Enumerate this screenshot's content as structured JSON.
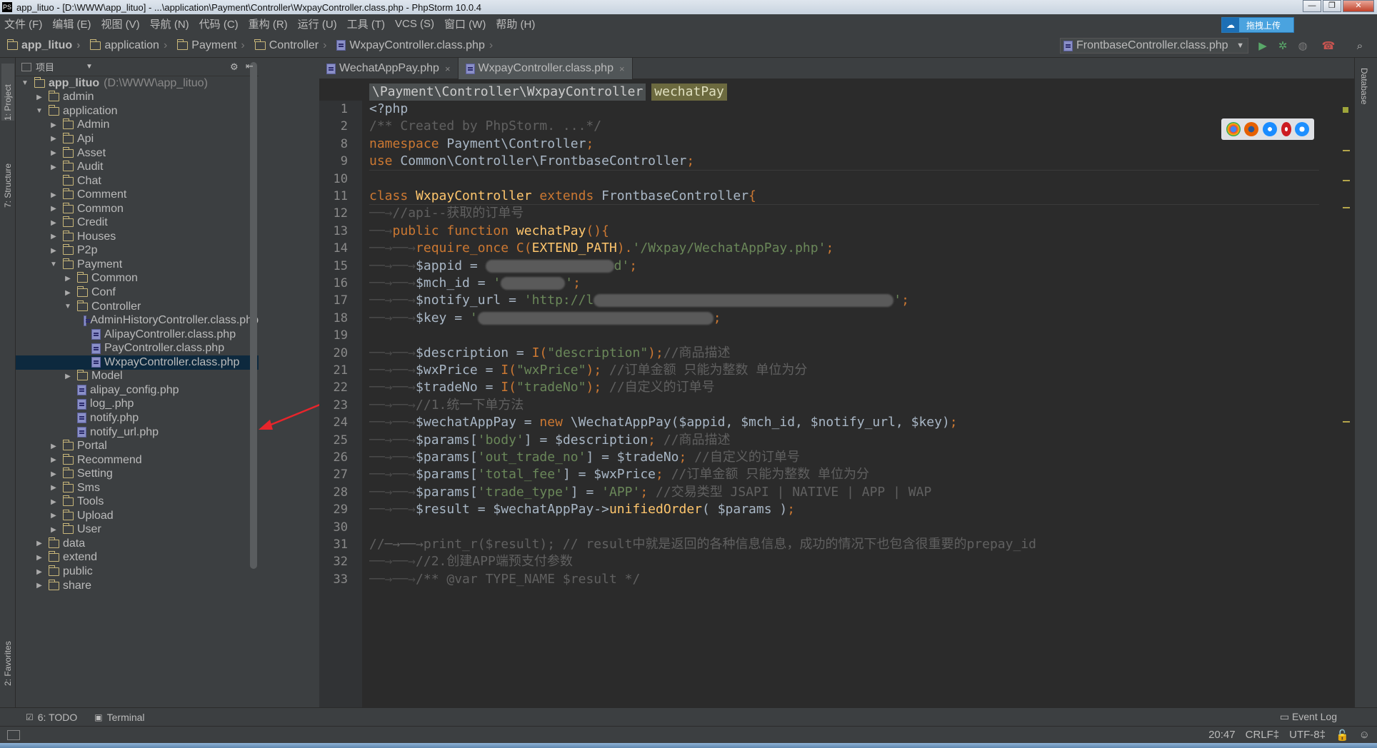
{
  "window": {
    "title": "app_lituo - [D:\\WWW\\app_lituo] - ...\\application\\Payment\\Controller\\WxpayController.class.php - PhpStorm 10.0.4",
    "app_icon_text": "PS",
    "minimize": "—",
    "restore": "❐",
    "close": "✕"
  },
  "menu": {
    "items": [
      "文件 (F)",
      "编辑 (E)",
      "视图 (V)",
      "导航 (N)",
      "代码 (C)",
      "重构 (R)",
      "运行 (U)",
      "工具 (T)",
      "VCS (S)",
      "窗口 (W)",
      "帮助 (H)"
    ],
    "upload_label": "拖拽上传"
  },
  "navbar": {
    "crumbs": [
      "app_lituo",
      "application",
      "Payment",
      "Controller",
      "WxpayController.class.php"
    ],
    "run_config": "FrontbaseController.class.php"
  },
  "left_strip": {
    "project": "1: Project",
    "structure": "7: Structure",
    "favorites": "2: Favorites"
  },
  "project_panel": {
    "header": "项目",
    "root": "app_lituo",
    "root_path": "(D:\\WWW\\app_lituo)",
    "tree": [
      {
        "label": "admin",
        "indent": 1,
        "arrow": "▶",
        "type": "folder"
      },
      {
        "label": "application",
        "indent": 1,
        "arrow": "▼",
        "type": "folder"
      },
      {
        "label": "Admin",
        "indent": 2,
        "arrow": "▶",
        "type": "folder"
      },
      {
        "label": "Api",
        "indent": 2,
        "arrow": "▶",
        "type": "folder"
      },
      {
        "label": "Asset",
        "indent": 2,
        "arrow": "▶",
        "type": "folder"
      },
      {
        "label": "Audit",
        "indent": 2,
        "arrow": "▶",
        "type": "folder"
      },
      {
        "label": "Chat",
        "indent": 2,
        "arrow": "",
        "type": "folder"
      },
      {
        "label": "Comment",
        "indent": 2,
        "arrow": "▶",
        "type": "folder"
      },
      {
        "label": "Common",
        "indent": 2,
        "arrow": "▶",
        "type": "folder"
      },
      {
        "label": "Credit",
        "indent": 2,
        "arrow": "▶",
        "type": "folder"
      },
      {
        "label": "Houses",
        "indent": 2,
        "arrow": "▶",
        "type": "folder"
      },
      {
        "label": "P2p",
        "indent": 2,
        "arrow": "▶",
        "type": "folder"
      },
      {
        "label": "Payment",
        "indent": 2,
        "arrow": "▼",
        "type": "folder"
      },
      {
        "label": "Common",
        "indent": 3,
        "arrow": "▶",
        "type": "folder"
      },
      {
        "label": "Conf",
        "indent": 3,
        "arrow": "▶",
        "type": "folder"
      },
      {
        "label": "Controller",
        "indent": 3,
        "arrow": "▼",
        "type": "folder"
      },
      {
        "label": "AdminHistoryController.class.php",
        "indent": 4,
        "arrow": "",
        "type": "php"
      },
      {
        "label": "AlipayController.class.php",
        "indent": 4,
        "arrow": "",
        "type": "php"
      },
      {
        "label": "PayController.class.php",
        "indent": 4,
        "arrow": "",
        "type": "php"
      },
      {
        "label": "WxpayController.class.php",
        "indent": 4,
        "arrow": "",
        "type": "php",
        "selected": true
      },
      {
        "label": "Model",
        "indent": 3,
        "arrow": "▶",
        "type": "folder"
      },
      {
        "label": "alipay_config.php",
        "indent": 3,
        "arrow": "",
        "type": "php"
      },
      {
        "label": "log_.php",
        "indent": 3,
        "arrow": "",
        "type": "php"
      },
      {
        "label": "notify.php",
        "indent": 3,
        "arrow": "",
        "type": "php"
      },
      {
        "label": "notify_url.php",
        "indent": 3,
        "arrow": "",
        "type": "php"
      },
      {
        "label": "Portal",
        "indent": 2,
        "arrow": "▶",
        "type": "folder"
      },
      {
        "label": "Recommend",
        "indent": 2,
        "arrow": "▶",
        "type": "folder"
      },
      {
        "label": "Setting",
        "indent": 2,
        "arrow": "▶",
        "type": "folder"
      },
      {
        "label": "Sms",
        "indent": 2,
        "arrow": "▶",
        "type": "folder"
      },
      {
        "label": "Tools",
        "indent": 2,
        "arrow": "▶",
        "type": "folder"
      },
      {
        "label": "Upload",
        "indent": 2,
        "arrow": "▶",
        "type": "folder"
      },
      {
        "label": "User",
        "indent": 2,
        "arrow": "▶",
        "type": "folder"
      },
      {
        "label": "data",
        "indent": 1,
        "arrow": "▶",
        "type": "folder"
      },
      {
        "label": "extend",
        "indent": 1,
        "arrow": "▶",
        "type": "folder"
      },
      {
        "label": "public",
        "indent": 1,
        "arrow": "▶",
        "type": "folder"
      },
      {
        "label": "share",
        "indent": 1,
        "arrow": "▶",
        "type": "folder"
      }
    ]
  },
  "editor": {
    "tabs": [
      {
        "label": "WechatAppPay.php",
        "active": false
      },
      {
        "label": "WxpayController.class.php",
        "active": true
      }
    ],
    "breadcrumb_class": "\\Payment\\Controller\\WxpayController",
    "breadcrumb_method": "wechatPay",
    "line_numbers": [
      "1",
      "2",
      "8",
      "9",
      "10",
      "11",
      "12",
      "13",
      "14",
      "15",
      "16",
      "17",
      "18",
      "19",
      "20",
      "21",
      "22",
      "23",
      "24",
      "25",
      "26",
      "27",
      "28",
      "29",
      "30",
      "31",
      "32",
      "33"
    ],
    "lines": [
      [
        {
          "t": "<?php",
          "c": "var"
        }
      ],
      [
        {
          "t": "/** Created by PhpStorm. ...*/",
          "c": "cmt"
        }
      ],
      [
        {
          "t": "namespace ",
          "c": "kw"
        },
        {
          "t": "Payment\\Controller",
          "c": "var"
        },
        {
          "t": ";",
          "c": "kw"
        }
      ],
      [
        {
          "t": "use ",
          "c": "kw"
        },
        {
          "t": "Common\\Controller\\FrontbaseController",
          "c": "var"
        },
        {
          "t": ";",
          "c": "kw"
        }
      ],
      [],
      [
        {
          "t": "class ",
          "c": "kw"
        },
        {
          "t": "WxpayController ",
          "c": "fn"
        },
        {
          "t": "extends ",
          "c": "kw"
        },
        {
          "t": "FrontbaseController",
          "c": "var"
        },
        {
          "t": "{",
          "c": "kw"
        }
      ],
      [
        {
          "t": "──→",
          "c": "ind"
        },
        {
          "t": "//api--获取的订单号",
          "c": "cmt"
        }
      ],
      [
        {
          "t": "──→",
          "c": "ind"
        },
        {
          "t": "public function ",
          "c": "kw"
        },
        {
          "t": "wechatPay",
          "c": "fn"
        },
        {
          "t": "(){",
          "c": "kw"
        }
      ],
      [
        {
          "t": "──→──→",
          "c": "ind"
        },
        {
          "t": "require_once ",
          "c": "kw"
        },
        {
          "t": "C(",
          "c": "kw"
        },
        {
          "t": "EXTEND_PATH",
          "c": "fn"
        },
        {
          "t": ").",
          "c": "kw"
        },
        {
          "t": "'/Wxpay/WechatAppPay.php'",
          "c": "str"
        },
        {
          "t": ";",
          "c": "kw"
        }
      ],
      [
        {
          "t": "──→──→",
          "c": "ind"
        },
        {
          "t": "$appid = ",
          "c": "var"
        },
        {
          "t": "REDACT:180",
          "c": "redact"
        },
        {
          "t": "d'",
          "c": "str"
        },
        {
          "t": ";",
          "c": "kw"
        }
      ],
      [
        {
          "t": "──→──→",
          "c": "ind"
        },
        {
          "t": "$mch_id = ",
          "c": "var"
        },
        {
          "t": "'",
          "c": "str"
        },
        {
          "t": "REDACT:90",
          "c": "redact"
        },
        {
          "t": "'",
          "c": "str"
        },
        {
          "t": ";",
          "c": "kw"
        }
      ],
      [
        {
          "t": "──→──→",
          "c": "ind"
        },
        {
          "t": "$notify_url = ",
          "c": "var"
        },
        {
          "t": "'http://l",
          "c": "str"
        },
        {
          "t": "REDACT:420",
          "c": "redact"
        },
        {
          "t": "'",
          "c": "str"
        },
        {
          "t": ";",
          "c": "kw"
        }
      ],
      [
        {
          "t": "──→──→",
          "c": "ind"
        },
        {
          "t": "$key = ",
          "c": "var"
        },
        {
          "t": "'",
          "c": "str"
        },
        {
          "t": "REDACT:330",
          "c": "redact"
        },
        {
          "t": ";",
          "c": "kw"
        }
      ],
      [],
      [
        {
          "t": "──→──→",
          "c": "ind"
        },
        {
          "t": "$description = ",
          "c": "var"
        },
        {
          "t": "I(",
          "c": "kw"
        },
        {
          "t": "\"description\"",
          "c": "str"
        },
        {
          "t": ");",
          "c": "kw"
        },
        {
          "t": "//商品描述",
          "c": "cmt"
        }
      ],
      [
        {
          "t": "──→──→",
          "c": "ind"
        },
        {
          "t": "$wxPrice = ",
          "c": "var"
        },
        {
          "t": "I(",
          "c": "kw"
        },
        {
          "t": "\"wxPrice\"",
          "c": "str"
        },
        {
          "t": "); ",
          "c": "kw"
        },
        {
          "t": "//订单金额 只能为整数 单位为分",
          "c": "cmt"
        }
      ],
      [
        {
          "t": "──→──→",
          "c": "ind"
        },
        {
          "t": "$tradeNo = ",
          "c": "var"
        },
        {
          "t": "I(",
          "c": "kw"
        },
        {
          "t": "\"tradeNo\"",
          "c": "str"
        },
        {
          "t": "); ",
          "c": "kw"
        },
        {
          "t": "//自定义的订单号",
          "c": "cmt"
        }
      ],
      [
        {
          "t": "──→──→",
          "c": "ind"
        },
        {
          "t": "//1.统一下单方法",
          "c": "cmt"
        }
      ],
      [
        {
          "t": "──→──→",
          "c": "ind"
        },
        {
          "t": "$wechatAppPay = ",
          "c": "var"
        },
        {
          "t": "new ",
          "c": "kw"
        },
        {
          "t": "\\WechatAppPay($appid, $mch_id, $notify_url, $key)",
          "c": "var"
        },
        {
          "t": ";",
          "c": "kw"
        }
      ],
      [
        {
          "t": "──→──→",
          "c": "ind"
        },
        {
          "t": "$params[",
          "c": "var"
        },
        {
          "t": "'body'",
          "c": "str"
        },
        {
          "t": "] = $description",
          "c": "var"
        },
        {
          "t": "; ",
          "c": "kw"
        },
        {
          "t": "//商品描述",
          "c": "cmt"
        }
      ],
      [
        {
          "t": "──→──→",
          "c": "ind"
        },
        {
          "t": "$params[",
          "c": "var"
        },
        {
          "t": "'out_trade_no'",
          "c": "str"
        },
        {
          "t": "] = $tradeNo",
          "c": "var"
        },
        {
          "t": "; ",
          "c": "kw"
        },
        {
          "t": "//自定义的订单号",
          "c": "cmt"
        }
      ],
      [
        {
          "t": "──→──→",
          "c": "ind"
        },
        {
          "t": "$params[",
          "c": "var"
        },
        {
          "t": "'total_fee'",
          "c": "str"
        },
        {
          "t": "] = $wxPrice",
          "c": "var"
        },
        {
          "t": "; ",
          "c": "kw"
        },
        {
          "t": "//订单金额 只能为整数 单位为分",
          "c": "cmt"
        }
      ],
      [
        {
          "t": "──→──→",
          "c": "ind"
        },
        {
          "t": "$params[",
          "c": "var"
        },
        {
          "t": "'trade_type'",
          "c": "str"
        },
        {
          "t": "] = ",
          "c": "var"
        },
        {
          "t": "'APP'",
          "c": "str"
        },
        {
          "t": "; ",
          "c": "kw"
        },
        {
          "t": "//交易类型 JSAPI | NATIVE | APP | WAP",
          "c": "cmt"
        }
      ],
      [
        {
          "t": "──→──→",
          "c": "ind"
        },
        {
          "t": "$result = $wechatAppPay->",
          "c": "var"
        },
        {
          "t": "unifiedOrder",
          "c": "fn"
        },
        {
          "t": "( $params )",
          "c": "var"
        },
        {
          "t": ";",
          "c": "kw"
        }
      ],
      [],
      [
        {
          "t": "//─→──→",
          "c": "cmt"
        },
        {
          "t": "print_r($result); // result中就是返回的各种信息信息，成功的情况下也包含很重要的prepay_id",
          "c": "cmt"
        }
      ],
      [
        {
          "t": "──→──→",
          "c": "ind"
        },
        {
          "t": "//2.创建APP端预支付参数",
          "c": "cmt"
        }
      ],
      [
        {
          "t": "──→──→",
          "c": "ind"
        },
        {
          "t": "/** @var TYPE_NAME $result */",
          "c": "cmt"
        }
      ]
    ]
  },
  "right_strip": {
    "database": "Database"
  },
  "bottom_tools": {
    "todo": "6: TODO",
    "terminal": "Terminal",
    "event_log": "Event Log"
  },
  "status": {
    "position": "20:47",
    "line_sep": "CRLF‡",
    "encoding": "UTF-8‡"
  },
  "colors": {
    "keyword": "#cc7832",
    "function": "#ffc66d",
    "string": "#6a8759",
    "comment": "#606060",
    "selection": "#0d293e",
    "annotation_arrow": "#e8252b"
  }
}
